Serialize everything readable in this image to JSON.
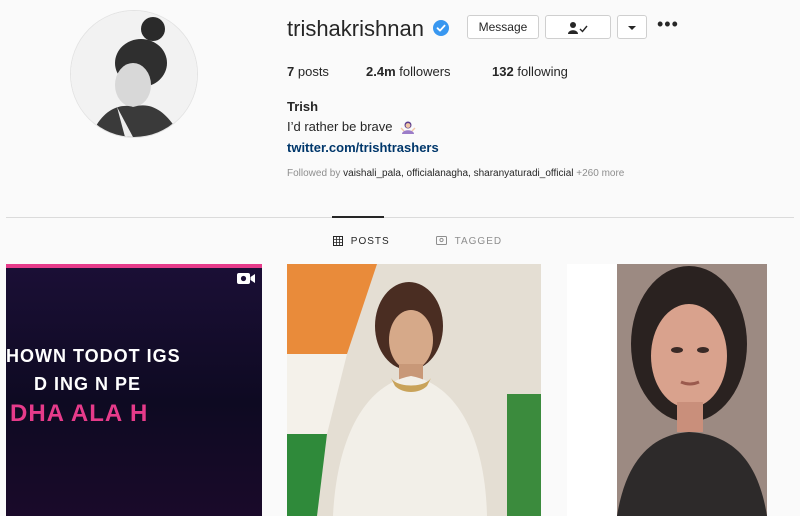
{
  "profile": {
    "username": "trishakrishnan",
    "verified": true,
    "buttons": {
      "message": "Message",
      "more_icon": "caret-down-icon",
      "options_icon": "more-dots-icon"
    },
    "stats": {
      "posts": "7",
      "posts_label": "posts",
      "followers": "2.4m",
      "followers_label": "followers",
      "following": "132",
      "following_label": "following"
    },
    "full_name": "Trish",
    "bio": "I’d rather be brave",
    "link": "twitter.com/trishtrashers",
    "followed_by": {
      "prefix": "Followed by",
      "names": "vaishali_pala, officialanagha, sharanyaturadi_official",
      "more": "+260 more"
    }
  },
  "tabs": [
    {
      "label": "POSTS",
      "icon": "grid-icon",
      "active": true
    },
    {
      "label": "TAGGED",
      "icon": "tag-icon",
      "active": false
    }
  ],
  "posts": [
    {
      "type": "video",
      "text_lines": [
        "HOWN   TODOT IGS",
        "D  ING  N  PE",
        "DHA  ALA  H"
      ]
    },
    {
      "type": "photo"
    },
    {
      "type": "photo"
    }
  ],
  "colors": {
    "verified_badge": "#3897f0",
    "link": "#00376b",
    "accent_pink": "#e63b8a"
  }
}
